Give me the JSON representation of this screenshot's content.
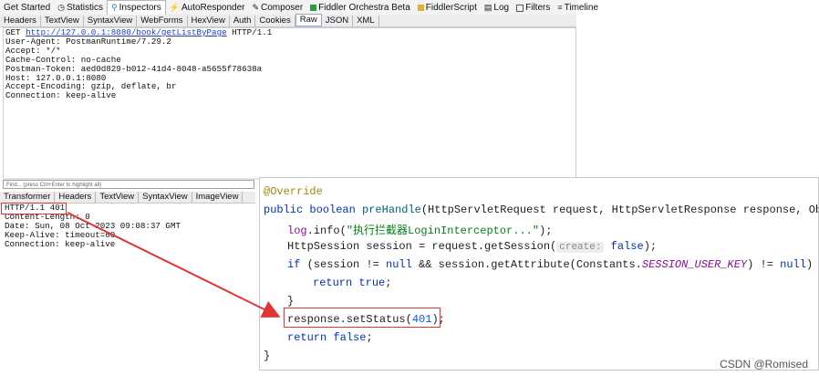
{
  "fiddler": {
    "top_tabs": [
      {
        "label": "Get Started",
        "icon": ""
      },
      {
        "label": "Statistics",
        "icon": "stopwatch-icon"
      },
      {
        "label": "Inspectors",
        "icon": "magnifier-icon"
      },
      {
        "label": "AutoResponder",
        "icon": "lightning-icon"
      },
      {
        "label": "Composer",
        "icon": "compose-icon"
      },
      {
        "label": "Fiddler Orchestra Beta",
        "icon": "orchestra-icon"
      },
      {
        "label": "FiddlerScript",
        "icon": "script-icon"
      },
      {
        "label": "Log",
        "icon": "log-icon"
      },
      {
        "label": "Filters",
        "icon": "checkbox-icon"
      },
      {
        "label": "Timeline",
        "icon": "timeline-icon"
      }
    ],
    "request_tabs": [
      "Headers",
      "TextView",
      "SyntaxView",
      "WebForms",
      "HexView",
      "Auth",
      "Cookies",
      "Raw",
      "JSON",
      "XML"
    ],
    "request_active": "Raw",
    "request": {
      "method": "GET ",
      "url": "http://127.0.0.1:8080/book/getListByPage",
      "protocol": " HTTP/1.1",
      "headers": [
        "User-Agent: PostmanRuntime/7.29.2",
        "Accept: */*",
        "Cache-Control: no-cache",
        "Postman-Token: aed0d829-b012-41d4-8048-a5655f78638a",
        "Host: 127.0.0.1:8080",
        "Accept-Encoding: gzip, deflate, br",
        "Connection: keep-alive"
      ]
    },
    "find_placeholder": "Find... (press Ctrl+Enter to highlight all)",
    "response_tabs": [
      "Transformer",
      "Headers",
      "TextView",
      "SyntaxView",
      "ImageView"
    ],
    "response": {
      "status_line": "HTTP/1.1 401",
      "headers": [
        "Content-Length: 0",
        "Date: Sun, 08 Oct 2023 09:08:37 GMT",
        "Keep-Alive: timeout=60",
        "Connection: keep-alive"
      ]
    }
  },
  "code": {
    "annotation": "@Override",
    "signature_kw": "public boolean ",
    "method_name": "preHandle",
    "signature_rest": "(HttpServletRequest request, HttpServletResponse response, Object",
    "log_field": "log",
    "log_call": ".info(",
    "log_string": "\"执行拦截器LoginInterceptor...\"",
    "log_end": ");",
    "session_line_a": "HttpSession session = request.getSession(",
    "session_hint": "create:",
    "session_false": "false",
    "session_line_b": ");",
    "if_kw": "if",
    "if_a": " (session != ",
    "null_kw": "null",
    "if_b": " && session.getAttribute(Constants.",
    "if_const": "SESSION_USER_KEY",
    "if_c": ") != ",
    "if_d": ") {",
    "return_kw": "return",
    "return_true": " true",
    "semicolon": ";",
    "close_brace": "}",
    "set_status_a": "response.setStatus(",
    "set_status_num": "401",
    "set_status_b": ");",
    "return_false": " false",
    "final_brace": "}"
  },
  "watermark": "CSDN @Romised",
  "colors": {
    "highlight_box": "#e03535",
    "keyword": "#0033b3",
    "string": "#067d17",
    "number": "#1750eb"
  }
}
